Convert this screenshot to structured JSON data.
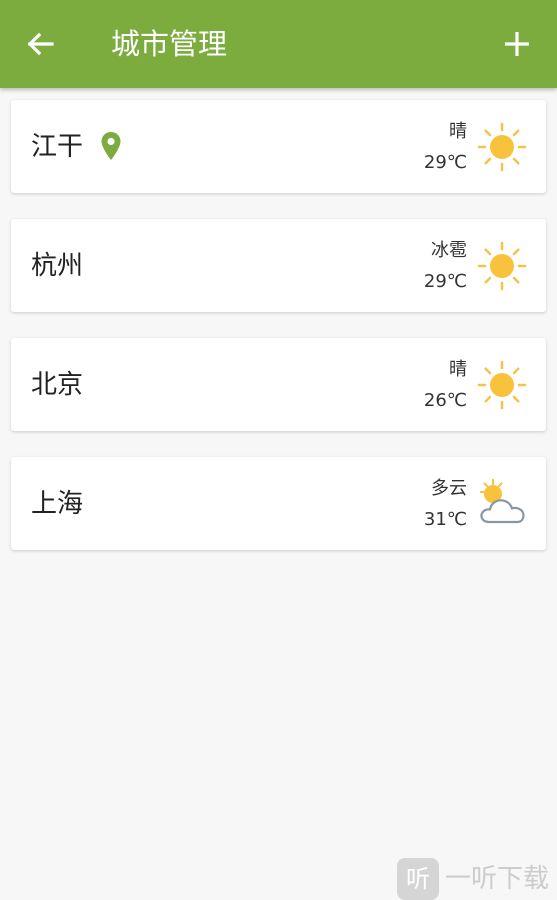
{
  "header": {
    "title": "城市管理",
    "back_icon": "arrow-left-icon",
    "add_icon": "plus-icon",
    "color": "#7cab3e"
  },
  "cities": [
    {
      "name": "江干",
      "condition": "晴",
      "temp": "29℃",
      "icon": "sun-icon",
      "located": true
    },
    {
      "name": "杭州",
      "condition": "冰雹",
      "temp": "29℃",
      "icon": "sun-icon",
      "located": false
    },
    {
      "name": "北京",
      "condition": "晴",
      "temp": "26℃",
      "icon": "sun-icon",
      "located": false
    },
    {
      "name": "上海",
      "condition": "多云",
      "temp": "31℃",
      "icon": "partly-cloudy-icon",
      "located": false
    }
  ],
  "watermark": {
    "badge": "听",
    "text": "一听下载"
  }
}
